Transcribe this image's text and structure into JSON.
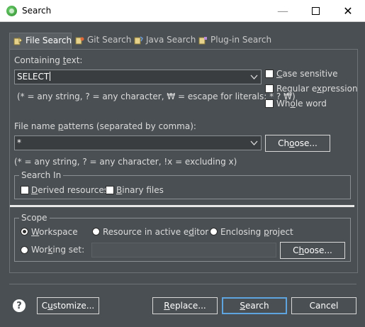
{
  "window": {
    "title": "Search",
    "minimize_glyph": "—",
    "close_glyph": "✕"
  },
  "tabs": [
    {
      "label": "File Search",
      "icon": "flashlight-icon",
      "active": true
    },
    {
      "label": "Git Search",
      "icon": "git-search-icon",
      "active": false
    },
    {
      "label": "Java Search",
      "icon": "java-search-icon",
      "active": false
    },
    {
      "label": "Plug-in Search",
      "icon": "plugin-search-icon",
      "active": false
    }
  ],
  "containing_text": {
    "label_pre": "Containing ",
    "label_mnemonic": "t",
    "label_post": "ext:",
    "value": "SELECT",
    "hint": "(* = any string, ? = any character, ₩ = escape for literals: * ? ₩)"
  },
  "options": {
    "case_sensitive": {
      "label_mnemonic": "C",
      "label_rest": "ase sensitive",
      "checked": false
    },
    "regular_expression": {
      "label_pre": "Regular e",
      "label_mnemonic": "x",
      "label_post": "pression",
      "checked": false
    },
    "whole_word": {
      "label_pre": "Wh",
      "label_mnemonic": "o",
      "label_post": "le word",
      "checked": false
    }
  },
  "file_name_patterns": {
    "label_pre": "File name ",
    "label_mnemonic": "p",
    "label_post": "atterns (separated by comma):",
    "value": "*",
    "choose_pre": "Ch",
    "choose_mnemonic": "o",
    "choose_post": "ose...",
    "hint": "(* = any string, ? = any character, !x = excluding x)"
  },
  "search_in": {
    "legend": "Search In",
    "derived": {
      "label_pre": "",
      "label_mnemonic": "D",
      "label_post": "erived resources",
      "checked": false
    },
    "binary": {
      "label_pre": "",
      "label_mnemonic": "B",
      "label_post": "inary files",
      "checked": false
    }
  },
  "scope": {
    "legend": "Scope",
    "workspace": {
      "label_mnemonic": "W",
      "label_rest": "orkspace",
      "selected": true
    },
    "resource": {
      "label_pre": "Resource in active e",
      "label_mnemonic": "d",
      "label_post": "itor",
      "selected": false
    },
    "enclosing": {
      "label_pre": "Enclosing ",
      "label_mnemonic": "p",
      "label_post": "roject",
      "selected": false
    },
    "working_set": {
      "label_pre": "Wor",
      "label_mnemonic": "k",
      "label_post": "ing set:",
      "selected": false,
      "value": ""
    },
    "choose_pre": "C",
    "choose_mnemonic": "h",
    "choose_post": "oose..."
  },
  "buttons": {
    "help": "?",
    "customize_pre": "C",
    "customize_mnemonic": "u",
    "customize_post": "stomize...",
    "replace_mnemonic": "R",
    "replace_post": "eplace...",
    "search_mnemonic": "S",
    "search_post": "earch",
    "cancel": "Cancel"
  },
  "colors": {
    "background": "#4a4f53",
    "default_button_border": "#5ea5e0"
  }
}
